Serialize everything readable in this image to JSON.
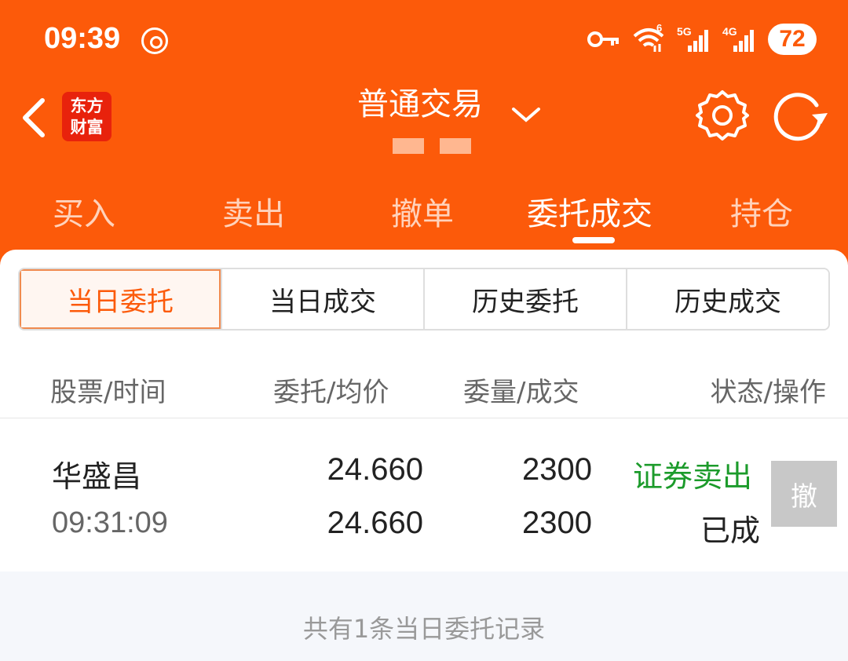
{
  "status_bar": {
    "time": "09:39",
    "net1": "5G",
    "net2": "4G",
    "wifi_badge": "6",
    "battery": "72"
  },
  "nav": {
    "logo_line1": "东方",
    "logo_line2": "财富",
    "title": "普通交易"
  },
  "tabs": [
    "买入",
    "卖出",
    "撤单",
    "委托成交",
    "持仓"
  ],
  "active_tab": "委托成交",
  "segments": [
    "当日委托",
    "当日成交",
    "历史委托",
    "历史成交"
  ],
  "active_segment": "当日委托",
  "columns": [
    "股票/时间",
    "委托/均价",
    "委量/成交",
    "状态/操作"
  ],
  "orders": [
    {
      "stock": "华盛昌",
      "time": "09:31:09",
      "order_price": "24.660",
      "avg_price": "24.660",
      "order_qty": "2300",
      "filled_qty": "2300",
      "type": "证券卖出",
      "status": "已成",
      "action": "撤"
    }
  ],
  "footer": "共有1条当日委托记录",
  "colors": {
    "brand": "#fc5a0a",
    "sell_green": "#1c9b2b",
    "disabled_button": "#c8c8c8"
  },
  "icons": [
    "back-icon",
    "gear-icon",
    "refresh-icon",
    "chevron-down-icon",
    "key-icon",
    "wifi-icon",
    "signal-icon"
  ]
}
